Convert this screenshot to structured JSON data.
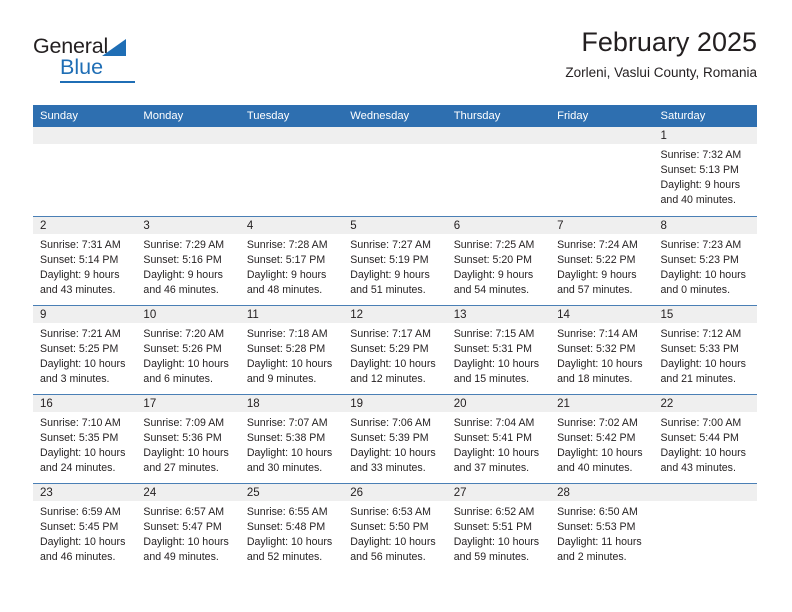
{
  "brand": {
    "name_part1": "General",
    "name_part2": "Blue"
  },
  "header": {
    "title": "February 2025",
    "subtitle": "Zorleni, Vaslui County, Romania"
  },
  "colors": {
    "header_blue": "#2e6fb0",
    "brand_blue": "#1f6eb5",
    "daynum_bg": "#efefef",
    "row_divider": "#4a7fb5",
    "text": "#231f20"
  },
  "weekday_headers": [
    "Sunday",
    "Monday",
    "Tuesday",
    "Wednesday",
    "Thursday",
    "Friday",
    "Saturday"
  ],
  "weeks": [
    [
      {
        "day": "",
        "empty": true
      },
      {
        "day": "",
        "empty": true
      },
      {
        "day": "",
        "empty": true
      },
      {
        "day": "",
        "empty": true
      },
      {
        "day": "",
        "empty": true
      },
      {
        "day": "",
        "empty": true
      },
      {
        "day": "1",
        "sunrise": "Sunrise: 7:32 AM",
        "sunset": "Sunset: 5:13 PM",
        "daylight_1": "Daylight: 9 hours",
        "daylight_2": "and 40 minutes."
      }
    ],
    [
      {
        "day": "2",
        "sunrise": "Sunrise: 7:31 AM",
        "sunset": "Sunset: 5:14 PM",
        "daylight_1": "Daylight: 9 hours",
        "daylight_2": "and 43 minutes."
      },
      {
        "day": "3",
        "sunrise": "Sunrise: 7:29 AM",
        "sunset": "Sunset: 5:16 PM",
        "daylight_1": "Daylight: 9 hours",
        "daylight_2": "and 46 minutes."
      },
      {
        "day": "4",
        "sunrise": "Sunrise: 7:28 AM",
        "sunset": "Sunset: 5:17 PM",
        "daylight_1": "Daylight: 9 hours",
        "daylight_2": "and 48 minutes."
      },
      {
        "day": "5",
        "sunrise": "Sunrise: 7:27 AM",
        "sunset": "Sunset: 5:19 PM",
        "daylight_1": "Daylight: 9 hours",
        "daylight_2": "and 51 minutes."
      },
      {
        "day": "6",
        "sunrise": "Sunrise: 7:25 AM",
        "sunset": "Sunset: 5:20 PM",
        "daylight_1": "Daylight: 9 hours",
        "daylight_2": "and 54 minutes."
      },
      {
        "day": "7",
        "sunrise": "Sunrise: 7:24 AM",
        "sunset": "Sunset: 5:22 PM",
        "daylight_1": "Daylight: 9 hours",
        "daylight_2": "and 57 minutes."
      },
      {
        "day": "8",
        "sunrise": "Sunrise: 7:23 AM",
        "sunset": "Sunset: 5:23 PM",
        "daylight_1": "Daylight: 10 hours",
        "daylight_2": "and 0 minutes."
      }
    ],
    [
      {
        "day": "9",
        "sunrise": "Sunrise: 7:21 AM",
        "sunset": "Sunset: 5:25 PM",
        "daylight_1": "Daylight: 10 hours",
        "daylight_2": "and 3 minutes."
      },
      {
        "day": "10",
        "sunrise": "Sunrise: 7:20 AM",
        "sunset": "Sunset: 5:26 PM",
        "daylight_1": "Daylight: 10 hours",
        "daylight_2": "and 6 minutes."
      },
      {
        "day": "11",
        "sunrise": "Sunrise: 7:18 AM",
        "sunset": "Sunset: 5:28 PM",
        "daylight_1": "Daylight: 10 hours",
        "daylight_2": "and 9 minutes."
      },
      {
        "day": "12",
        "sunrise": "Sunrise: 7:17 AM",
        "sunset": "Sunset: 5:29 PM",
        "daylight_1": "Daylight: 10 hours",
        "daylight_2": "and 12 minutes."
      },
      {
        "day": "13",
        "sunrise": "Sunrise: 7:15 AM",
        "sunset": "Sunset: 5:31 PM",
        "daylight_1": "Daylight: 10 hours",
        "daylight_2": "and 15 minutes."
      },
      {
        "day": "14",
        "sunrise": "Sunrise: 7:14 AM",
        "sunset": "Sunset: 5:32 PM",
        "daylight_1": "Daylight: 10 hours",
        "daylight_2": "and 18 minutes."
      },
      {
        "day": "15",
        "sunrise": "Sunrise: 7:12 AM",
        "sunset": "Sunset: 5:33 PM",
        "daylight_1": "Daylight: 10 hours",
        "daylight_2": "and 21 minutes."
      }
    ],
    [
      {
        "day": "16",
        "sunrise": "Sunrise: 7:10 AM",
        "sunset": "Sunset: 5:35 PM",
        "daylight_1": "Daylight: 10 hours",
        "daylight_2": "and 24 minutes."
      },
      {
        "day": "17",
        "sunrise": "Sunrise: 7:09 AM",
        "sunset": "Sunset: 5:36 PM",
        "daylight_1": "Daylight: 10 hours",
        "daylight_2": "and 27 minutes."
      },
      {
        "day": "18",
        "sunrise": "Sunrise: 7:07 AM",
        "sunset": "Sunset: 5:38 PM",
        "daylight_1": "Daylight: 10 hours",
        "daylight_2": "and 30 minutes."
      },
      {
        "day": "19",
        "sunrise": "Sunrise: 7:06 AM",
        "sunset": "Sunset: 5:39 PM",
        "daylight_1": "Daylight: 10 hours",
        "daylight_2": "and 33 minutes."
      },
      {
        "day": "20",
        "sunrise": "Sunrise: 7:04 AM",
        "sunset": "Sunset: 5:41 PM",
        "daylight_1": "Daylight: 10 hours",
        "daylight_2": "and 37 minutes."
      },
      {
        "day": "21",
        "sunrise": "Sunrise: 7:02 AM",
        "sunset": "Sunset: 5:42 PM",
        "daylight_1": "Daylight: 10 hours",
        "daylight_2": "and 40 minutes."
      },
      {
        "day": "22",
        "sunrise": "Sunrise: 7:00 AM",
        "sunset": "Sunset: 5:44 PM",
        "daylight_1": "Daylight: 10 hours",
        "daylight_2": "and 43 minutes."
      }
    ],
    [
      {
        "day": "23",
        "sunrise": "Sunrise: 6:59 AM",
        "sunset": "Sunset: 5:45 PM",
        "daylight_1": "Daylight: 10 hours",
        "daylight_2": "and 46 minutes."
      },
      {
        "day": "24",
        "sunrise": "Sunrise: 6:57 AM",
        "sunset": "Sunset: 5:47 PM",
        "daylight_1": "Daylight: 10 hours",
        "daylight_2": "and 49 minutes."
      },
      {
        "day": "25",
        "sunrise": "Sunrise: 6:55 AM",
        "sunset": "Sunset: 5:48 PM",
        "daylight_1": "Daylight: 10 hours",
        "daylight_2": "and 52 minutes."
      },
      {
        "day": "26",
        "sunrise": "Sunrise: 6:53 AM",
        "sunset": "Sunset: 5:50 PM",
        "daylight_1": "Daylight: 10 hours",
        "daylight_2": "and 56 minutes."
      },
      {
        "day": "27",
        "sunrise": "Sunrise: 6:52 AM",
        "sunset": "Sunset: 5:51 PM",
        "daylight_1": "Daylight: 10 hours",
        "daylight_2": "and 59 minutes."
      },
      {
        "day": "28",
        "sunrise": "Sunrise: 6:50 AM",
        "sunset": "Sunset: 5:53 PM",
        "daylight_1": "Daylight: 11 hours",
        "daylight_2": "and 2 minutes."
      },
      {
        "day": "",
        "empty": true
      }
    ]
  ]
}
